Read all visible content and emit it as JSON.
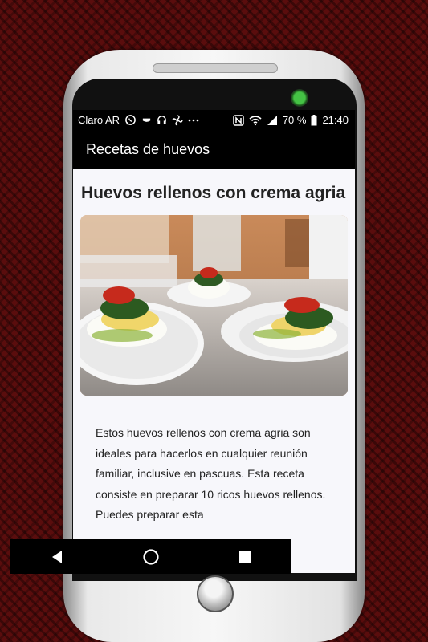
{
  "status_bar": {
    "carrier": "Claro AR",
    "battery": "70 %",
    "time": "21:40",
    "icons": [
      "whatsapp-icon",
      "notification-icon",
      "headset-icon",
      "fan-icon",
      "more-icon",
      "nfc-icon",
      "wifi-icon",
      "signal-icon",
      "battery-icon"
    ]
  },
  "app_bar": {
    "title": "Recetas de huevos"
  },
  "recipe": {
    "title": "Huevos rellenos con crema agria",
    "description": "Estos huevos rellenos con crema agria son ideales para hacerlos en cualquier reunión familiar, inclusive en pascuas. Esta receta consiste en preparar 10 ricos huevos rellenos. Puedes preparar esta"
  },
  "nav_bar": {
    "back": "back-icon",
    "home": "home-icon",
    "recents": "recents-icon"
  },
  "colors": {
    "background": "#5a0d0d",
    "screen": "#f7f7fb",
    "bars": "#000000"
  }
}
